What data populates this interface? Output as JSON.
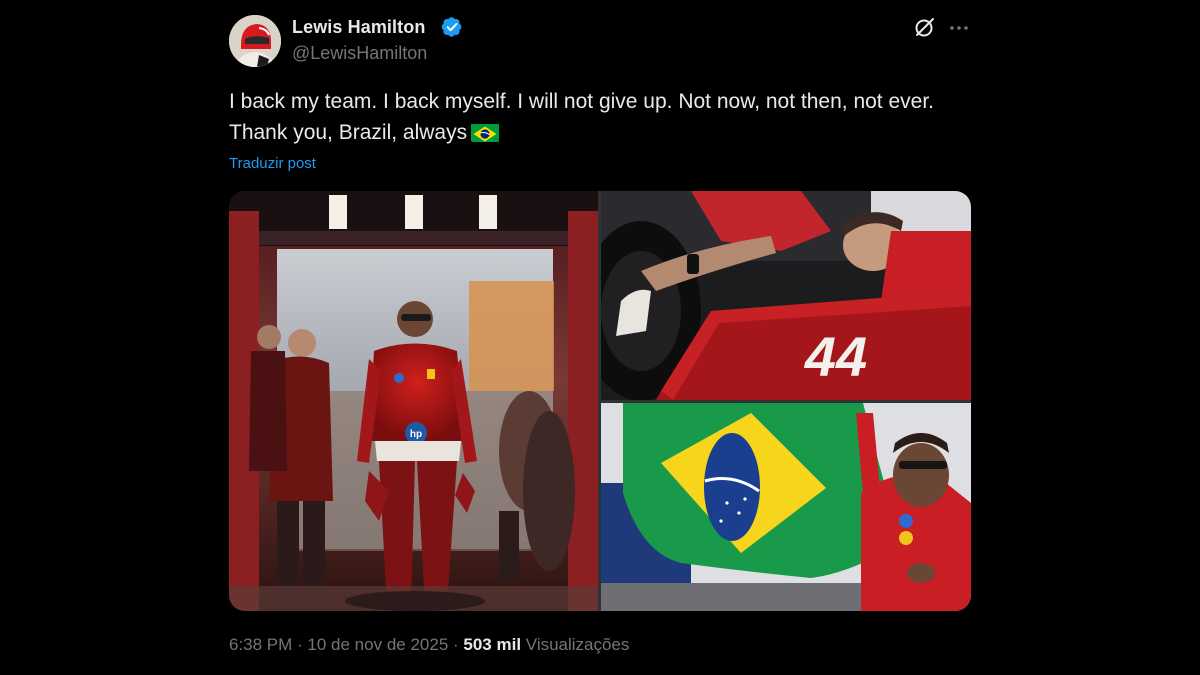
{
  "author": {
    "display_name": "Lewis Hamilton",
    "handle": "@LewisHamilton",
    "verified": true
  },
  "tweet": {
    "text": "I back my team. I back myself. I will not give up. Not now, not then, not ever. Thank you, Brazil, always",
    "emoji": "brazil-flag",
    "translate_label": "Traduzir post"
  },
  "media": {
    "car_number": "44",
    "sponsor_label": "hp"
  },
  "meta": {
    "time": "6:38 PM",
    "separator": " · ",
    "date": "10 de nov de 2025",
    "views_count": "503 mil",
    "views_label": "Visualizações"
  },
  "icons": {
    "grok": "grok-icon",
    "more": "more-icon",
    "verified": "verified-badge-icon"
  },
  "colors": {
    "background": "#000000",
    "text_primary": "#e7e9ea",
    "text_secondary": "#71767b",
    "accent": "#1d9bf0"
  }
}
